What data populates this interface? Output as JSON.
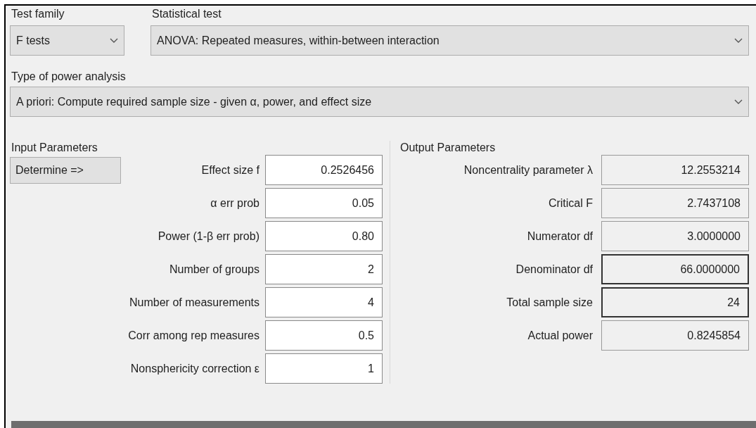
{
  "test_family": {
    "label": "Test family",
    "value": "F tests"
  },
  "statistical_test": {
    "label": "Statistical test",
    "value": "ANOVA: Repeated measures, within-between interaction"
  },
  "power_analysis_type": {
    "label": "Type of power analysis",
    "value": "A priori: Compute required sample size - given α, power, and effect size"
  },
  "input_parameters": {
    "title": "Input Parameters",
    "determine_button": "Determine =>",
    "fields": [
      {
        "label": "Effect size f",
        "value": "0.2526456"
      },
      {
        "label": "α err prob",
        "value": "0.05"
      },
      {
        "label": "Power (1-β err prob)",
        "value": "0.80"
      },
      {
        "label": "Number of groups",
        "value": "2"
      },
      {
        "label": "Number of measurements",
        "value": "4"
      },
      {
        "label": "Corr among rep measures",
        "value": "0.5"
      },
      {
        "label": "Nonsphericity correction ε",
        "value": "1"
      }
    ]
  },
  "output_parameters": {
    "title": "Output Parameters",
    "fields": [
      {
        "label": "Noncentrality parameter λ",
        "value": "12.2553214",
        "highlighted": false
      },
      {
        "label": "Critical F",
        "value": "2.7437108",
        "highlighted": false
      },
      {
        "label": "Numerator df",
        "value": "3.0000000",
        "highlighted": false
      },
      {
        "label": "Denominator df",
        "value": "66.0000000",
        "highlighted": true
      },
      {
        "label": "Total sample size",
        "value": "24",
        "highlighted": true
      },
      {
        "label": "Actual power",
        "value": "0.8245854",
        "highlighted": false
      }
    ]
  }
}
